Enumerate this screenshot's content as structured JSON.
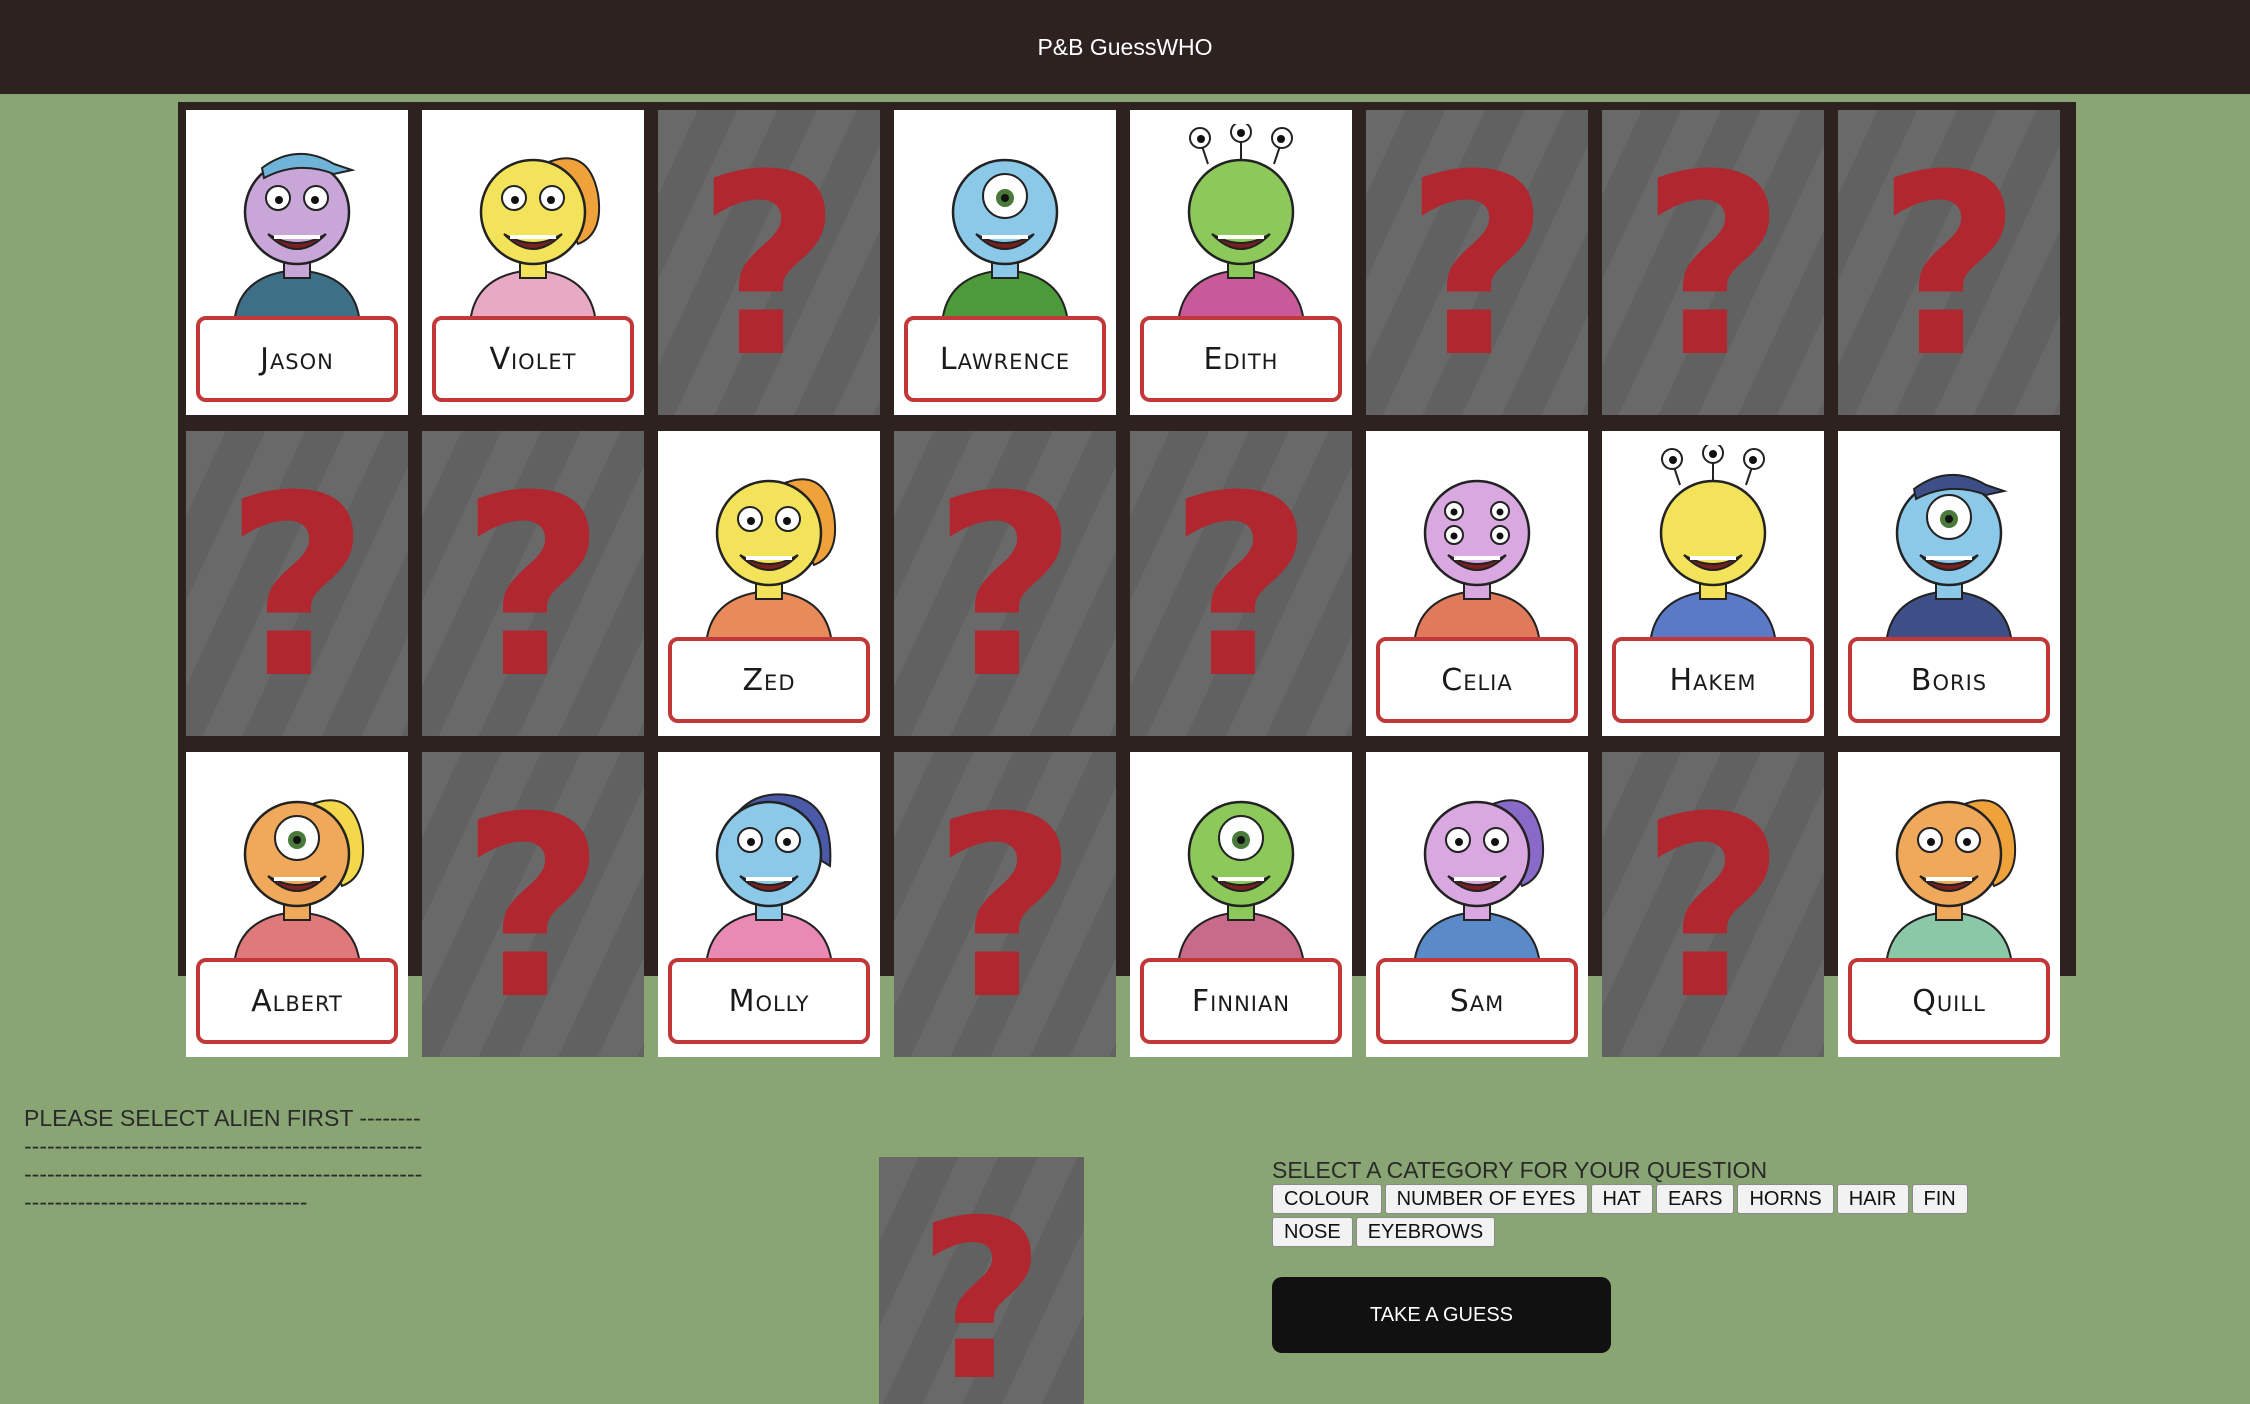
{
  "app": {
    "title": "P&B GuessWHO"
  },
  "cards": [
    {
      "name": "Jason",
      "hidden": false,
      "skin": "#c8a6d8",
      "outfit": "#3d6f86",
      "hat": "#6fb3d8",
      "eyes": 2
    },
    {
      "name": "Violet",
      "hidden": false,
      "skin": "#f2e35a",
      "outfit": "#e8a9c4",
      "fin": "#f0a23a",
      "eyes": 2
    },
    {
      "name": "",
      "hidden": true
    },
    {
      "name": "Lawrence",
      "hidden": false,
      "skin": "#8cc8e8",
      "outfit": "#4c9a3a",
      "eyes": 1
    },
    {
      "name": "Edith",
      "hidden": false,
      "skin": "#8dc85a",
      "outfit": "#c85a9a",
      "eyes": 3
    },
    {
      "name": "",
      "hidden": true
    },
    {
      "name": "",
      "hidden": true
    },
    {
      "name": "",
      "hidden": true
    },
    {
      "name": "",
      "hidden": true
    },
    {
      "name": "",
      "hidden": true
    },
    {
      "name": "Zed",
      "hidden": false,
      "skin": "#f2e35a",
      "outfit": "#e88a5a",
      "fin": "#f0a23a",
      "eyes": 2
    },
    {
      "name": "",
      "hidden": true
    },
    {
      "name": "",
      "hidden": true
    },
    {
      "name": "Celia",
      "hidden": false,
      "skin": "#d9a8e0",
      "outfit": "#e07a5a",
      "eyes": 4
    },
    {
      "name": "Hakem",
      "hidden": false,
      "skin": "#f2e35a",
      "outfit": "#5a7ac8",
      "eyes": 3
    },
    {
      "name": "Boris",
      "hidden": false,
      "skin": "#8cc8e8",
      "outfit": "#3d4f86",
      "hat": "#3d4f86",
      "eyes": 1
    },
    {
      "name": "Albert",
      "hidden": false,
      "skin": "#f0a85a",
      "outfit": "#e07a7a",
      "fin": "#f2d84a",
      "eyes": 1
    },
    {
      "name": "",
      "hidden": true
    },
    {
      "name": "Molly",
      "hidden": false,
      "skin": "#8cc8e8",
      "outfit": "#e88ab4",
      "hair": "#4a5aa8",
      "eyes": 2
    },
    {
      "name": "",
      "hidden": true
    },
    {
      "name": "Finnian",
      "hidden": false,
      "skin": "#8dc85a",
      "outfit": "#c86a8a",
      "eyes": 1
    },
    {
      "name": "Sam",
      "hidden": false,
      "skin": "#d9a8e0",
      "outfit": "#5a8ac8",
      "fin": "#8a6ac8",
      "eyes": 2
    },
    {
      "name": "",
      "hidden": true
    },
    {
      "name": "Quill",
      "hidden": false,
      "skin": "#f0a85a",
      "outfit": "#8ac8a8",
      "fin": "#f0a23a",
      "eyes": 2
    }
  ],
  "hidden_card_symbol": "?",
  "status": {
    "prompt": "PLEASE SELECT ALIEN FIRST -----------------------------------------------------------------------------------------------------------------------------------------------------"
  },
  "selected_card": {
    "symbol": "?"
  },
  "categories": {
    "heading": "SELECT A CATEGORY FOR YOUR QUESTION",
    "buttons": [
      "COLOUR",
      "NUMBER OF EYES",
      "HAT",
      "EARS",
      "HORNS",
      "HAIR",
      "FIN",
      "NOSE",
      "EYEBROWS"
    ]
  },
  "actions": {
    "guess_label": "TAKE A GUESS"
  },
  "colors": {
    "header_bg": "#2d2220",
    "page_bg": "#8aa574",
    "board_bg": "#2d2220",
    "card_back": "#616161",
    "question_mark": "#b02730",
    "name_border": "#c23838"
  }
}
